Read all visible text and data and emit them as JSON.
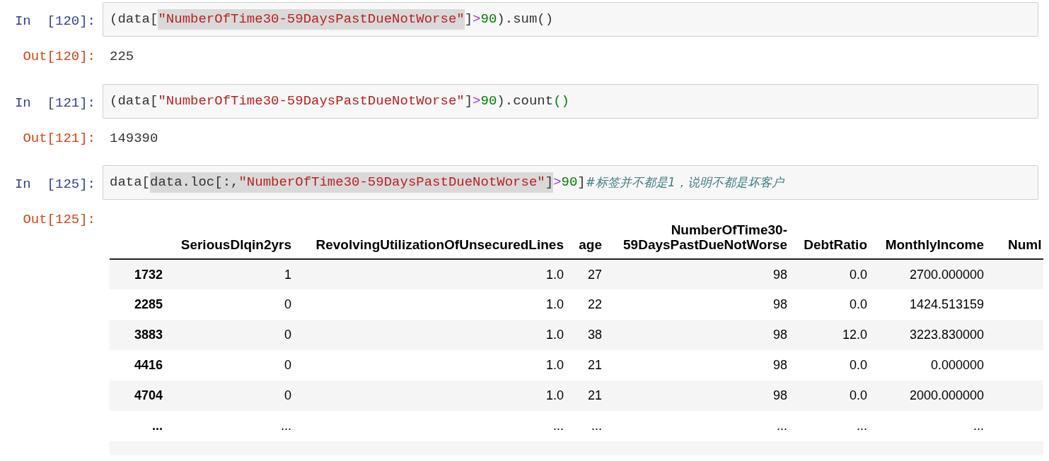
{
  "cells": [
    {
      "kind": "code",
      "prompt": "In  [120]:",
      "tokens": [
        {
          "text": "(data[",
          "kind": "plain",
          "highlighted": false
        },
        {
          "text": "\"NumberOfTime30-59DaysPastDueNotWorse\"",
          "kind": "string",
          "highlighted": true
        },
        {
          "text": "]",
          "kind": "plain",
          "highlighted": false
        },
        {
          "text": ">",
          "kind": "operator",
          "highlighted": false
        },
        {
          "text": "90",
          "kind": "number",
          "highlighted": false
        },
        {
          "text": ").sum()",
          "kind": "plain",
          "highlighted": false
        }
      ]
    },
    {
      "kind": "output",
      "prompt": "Out[120]:",
      "text": "225"
    },
    {
      "kind": "code",
      "prompt": "In  [121]:",
      "tokens": [
        {
          "text": "(data[",
          "kind": "plain",
          "highlighted": false
        },
        {
          "text": "\"NumberOfTime30-59DaysPastDueNotWorse\"",
          "kind": "string",
          "highlighted": false
        },
        {
          "text": "]",
          "kind": "plain",
          "highlighted": false
        },
        {
          "text": ">",
          "kind": "operator",
          "highlighted": false
        },
        {
          "text": "90",
          "kind": "number",
          "highlighted": false
        },
        {
          "text": ").count",
          "kind": "plain",
          "highlighted": false
        },
        {
          "text": "()",
          "kind": "number",
          "highlighted": false
        }
      ]
    },
    {
      "kind": "output",
      "prompt": "Out[121]:",
      "text": "149390"
    },
    {
      "kind": "code",
      "prompt": "In  [125]:",
      "tokens": [
        {
          "text": "data[",
          "kind": "plain",
          "highlighted": false
        },
        {
          "text": "data.loc[:,",
          "kind": "plain",
          "highlighted": true
        },
        {
          "text": "\"NumberOfTime30-59DaysPastDueNotWorse\"",
          "kind": "string",
          "highlighted": true
        },
        {
          "text": "]",
          "kind": "plain",
          "highlighted": true
        },
        {
          "text": ">",
          "kind": "operator",
          "highlighted": false
        },
        {
          "text": "90",
          "kind": "number",
          "highlighted": false
        },
        {
          "text": "]",
          "kind": "plain",
          "highlighted": false
        },
        {
          "text": "#标签并不都是1，说明不都是坏客户",
          "kind": "comment",
          "highlighted": false
        }
      ]
    },
    {
      "kind": "table",
      "prompt": "Out[125]:",
      "table": {
        "columns": [
          "SeriousDlqin2yrs",
          "RevolvingUtilizationOfUnsecuredLines",
          "age",
          "NumberOfTime30-59DaysPastDueNotWorse",
          "DebtRatio",
          "MonthlyIncome",
          "Numl"
        ],
        "rows": [
          {
            "index": "1732",
            "cells": [
              "1",
              "1.0",
              "27",
              "98",
              "0.0",
              "2700.000000"
            ]
          },
          {
            "index": "2285",
            "cells": [
              "0",
              "1.0",
              "22",
              "98",
              "0.0",
              "1424.513159"
            ]
          },
          {
            "index": "3883",
            "cells": [
              "0",
              "1.0",
              "38",
              "98",
              "12.0",
              "3223.830000"
            ]
          },
          {
            "index": "4416",
            "cells": [
              "0",
              "1.0",
              "21",
              "98",
              "0.0",
              "0.000000"
            ]
          },
          {
            "index": "4704",
            "cells": [
              "0",
              "1.0",
              "21",
              "98",
              "0.0",
              "2000.000000"
            ]
          },
          {
            "index": "...",
            "cells": [
              "...",
              "...",
              "...",
              "...",
              "...",
              "..."
            ]
          }
        ]
      }
    }
  ]
}
